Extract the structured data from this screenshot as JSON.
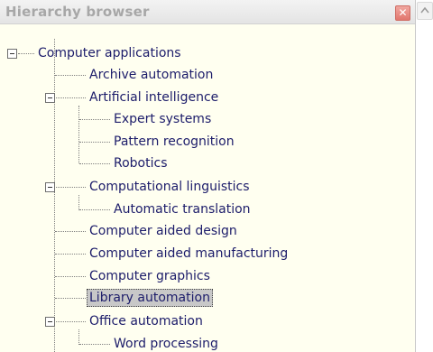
{
  "panel": {
    "title": "Hierarchy browser",
    "close_label": "✕"
  },
  "tree": {
    "root": "Computer applications",
    "items": [
      "Archive automation",
      "Artificial intelligence",
      "Expert systems",
      "Pattern recognition",
      "Robotics",
      "Computational linguistics",
      "Automatic translation",
      "Computer aided design",
      "Computer aided manufacturing",
      "Computer graphics",
      "Library automation",
      "Office automation",
      "Word processing"
    ]
  },
  "colors": {
    "background": "#fffff0",
    "text": "#1c1c6a",
    "selected": "#c8c8c8"
  }
}
